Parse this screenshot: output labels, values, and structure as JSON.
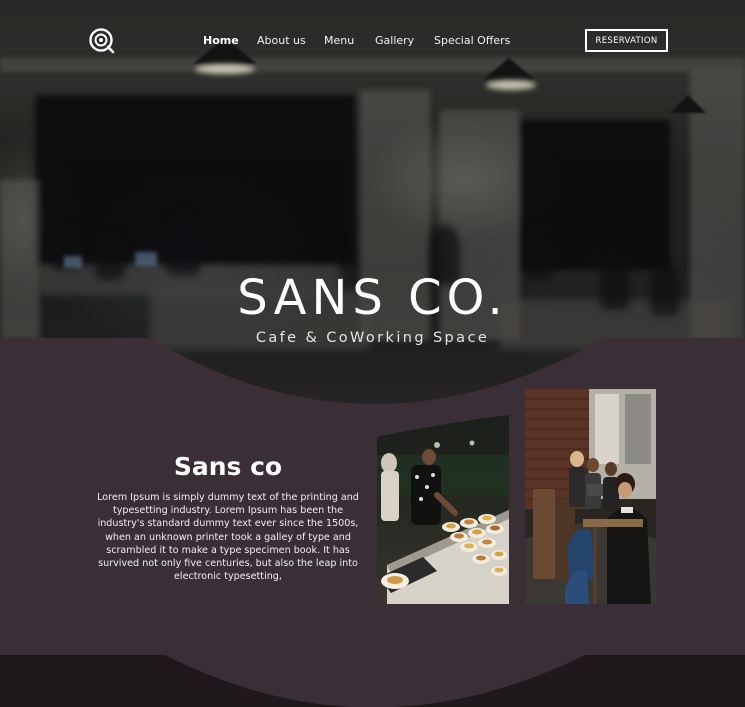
{
  "nav": {
    "logo_icon": "coffee-cup-icon",
    "links": [
      {
        "label": "Home",
        "active": true
      },
      {
        "label": "About us",
        "active": false
      },
      {
        "label": "Menu",
        "active": false
      },
      {
        "label": "Gallery",
        "active": false
      },
      {
        "label": "Special Offers",
        "active": false
      }
    ],
    "reservation_label": "RESERVATION"
  },
  "hero": {
    "title": "SANS CO.",
    "subtitle": "Cafe & CoWorking Space"
  },
  "about": {
    "title": "Sans co",
    "text": "Lorem Ipsum is simply dummy text of the printing and typesetting industry. Lorem Ipsum has been the industry's standard dummy text ever since the 1500s, when an unknown printer took a galley of type and scrambled it to make a type specimen book. It has survived not only five centuries, but also the leap into electronic typesetting,"
  },
  "colors": {
    "content_background": "#3a2f36",
    "footer_background": "#1f191d",
    "text": "#ffffff"
  }
}
